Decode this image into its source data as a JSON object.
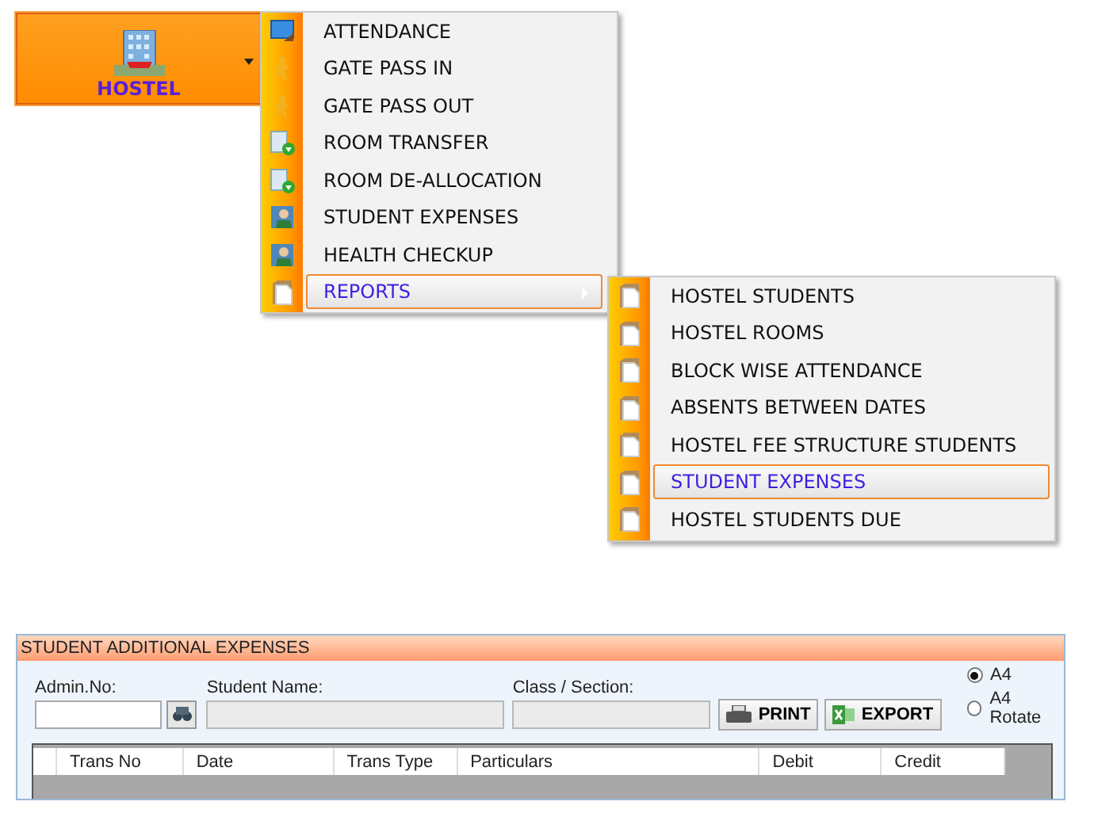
{
  "launcher": {
    "label": "HOSTEL"
  },
  "menu": {
    "items": [
      {
        "label": "ATTENDANCE",
        "kind": "monitor",
        "selected": false,
        "has_submenu": false
      },
      {
        "label": "GATE PASS IN",
        "kind": "walker",
        "selected": false,
        "has_submenu": false
      },
      {
        "label": "GATE PASS OUT",
        "kind": "walker",
        "selected": false,
        "has_submenu": false
      },
      {
        "label": "ROOM TRANSFER",
        "kind": "doc-add",
        "selected": false,
        "has_submenu": false
      },
      {
        "label": "ROOM DE-ALLOCATION",
        "kind": "doc-add",
        "selected": false,
        "has_submenu": false
      },
      {
        "label": "STUDENT EXPENSES",
        "kind": "person",
        "selected": false,
        "has_submenu": false
      },
      {
        "label": "HEALTH CHECKUP",
        "kind": "person",
        "selected": false,
        "has_submenu": false
      },
      {
        "label": "REPORTS",
        "kind": "page",
        "selected": true,
        "has_submenu": true
      }
    ]
  },
  "submenu": {
    "items": [
      {
        "label": "HOSTEL STUDENTS",
        "kind": "page",
        "selected": false
      },
      {
        "label": "HOSTEL ROOMS",
        "kind": "page",
        "selected": false
      },
      {
        "label": "BLOCK WISE ATTENDANCE",
        "kind": "page",
        "selected": false
      },
      {
        "label": "ABSENTS BETWEEN DATES",
        "kind": "page",
        "selected": false
      },
      {
        "label": "HOSTEL FEE STRUCTURE STUDENTS",
        "kind": "page",
        "selected": false
      },
      {
        "label": "STUDENT EXPENSES",
        "kind": "page",
        "selected": true
      },
      {
        "label": "HOSTEL STUDENTS DUE",
        "kind": "page",
        "selected": false
      }
    ]
  },
  "panel": {
    "title": "STUDENT ADDITIONAL EXPENSES",
    "fields": [
      {
        "label": "Admin.No:",
        "editable": true
      },
      {
        "label": "Student Name:",
        "editable": false
      },
      {
        "label": "Class / Section:",
        "editable": false
      }
    ],
    "buttons": [
      {
        "label": "PRINT",
        "kind": "printer"
      },
      {
        "label": "EXPORT",
        "kind": "excel"
      }
    ],
    "page_options": [
      {
        "label": "A4",
        "selected": true
      },
      {
        "label": "A4 Rotate",
        "selected": false
      }
    ],
    "table": {
      "columns": [
        "Trans No",
        "Date",
        "Trans Type",
        "Particulars",
        "Debit",
        "Credit"
      ]
    }
  }
}
